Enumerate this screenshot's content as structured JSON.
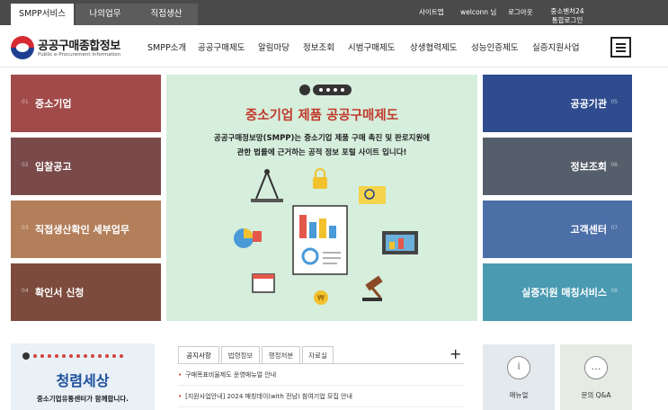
{
  "topbar": {
    "tabs": [
      {
        "label": "SMPP서비스"
      },
      {
        "label": "나의업무"
      },
      {
        "label": "직접생산"
      }
    ],
    "links": {
      "sitemap": "사이트맵",
      "user": "welconn 님",
      "logout": "로그아웃",
      "sme24_line1": "중소벤처24",
      "sme24_line2": "통합로그인"
    }
  },
  "header": {
    "logo_title": "공공구매종합정보",
    "logo_subtitle": "Public e-Procurement Information",
    "nav": [
      "SMPP소개",
      "공공구매제도",
      "알림마당",
      "정보조회",
      "시범구매제도",
      "상생협력제도",
      "성능인증제도",
      "실증지원사업"
    ]
  },
  "left_tiles": [
    {
      "num": "01",
      "label": "중소기업",
      "color": "#a14a4a"
    },
    {
      "num": "02",
      "label": "입찰공고",
      "color": "#7a4a4a"
    },
    {
      "num": "03",
      "label": "직접생산확인 세부업무",
      "color": "#b37e5a"
    },
    {
      "num": "04",
      "label": "확인서 신청",
      "color": "#7d4b3d"
    }
  ],
  "right_tiles": [
    {
      "num": "05",
      "label": "공공기관",
      "color": "#2f4c8e"
    },
    {
      "num": "06",
      "label": "정보조회",
      "color": "#555f6b"
    },
    {
      "num": "07",
      "label": "고객센터",
      "color": "#4c6fa8"
    },
    {
      "num": "08",
      "label": "실증지원 매칭서비스",
      "color": "#4a9ab1"
    }
  ],
  "banner": {
    "title": "중소기업 제품 공공구매제도",
    "desc_line1": "공공구매정보망(SMPP)는 중소기업 제품 구매 촉진 및 판로지원에",
    "desc_line2": "관한 법률에 근거하는 공적 정보 포털 사이트 입니다!"
  },
  "promo": {
    "title": "청렴세상",
    "subtitle": "중소기업유통센터가 함께합니다."
  },
  "notice": {
    "tabs": [
      "공지사항",
      "법령정보",
      "행정처분",
      "자료실"
    ],
    "items": [
      "구매목표비율제도 운영매뉴얼 안내",
      "[지원사업안내] 2024 매칭데이(with 전남) 참여기업 모집 안내"
    ]
  },
  "quick": [
    {
      "label": "매뉴얼",
      "icon": "info-icon"
    },
    {
      "label": "문의 Q&A",
      "icon": "chat-icon"
    }
  ]
}
